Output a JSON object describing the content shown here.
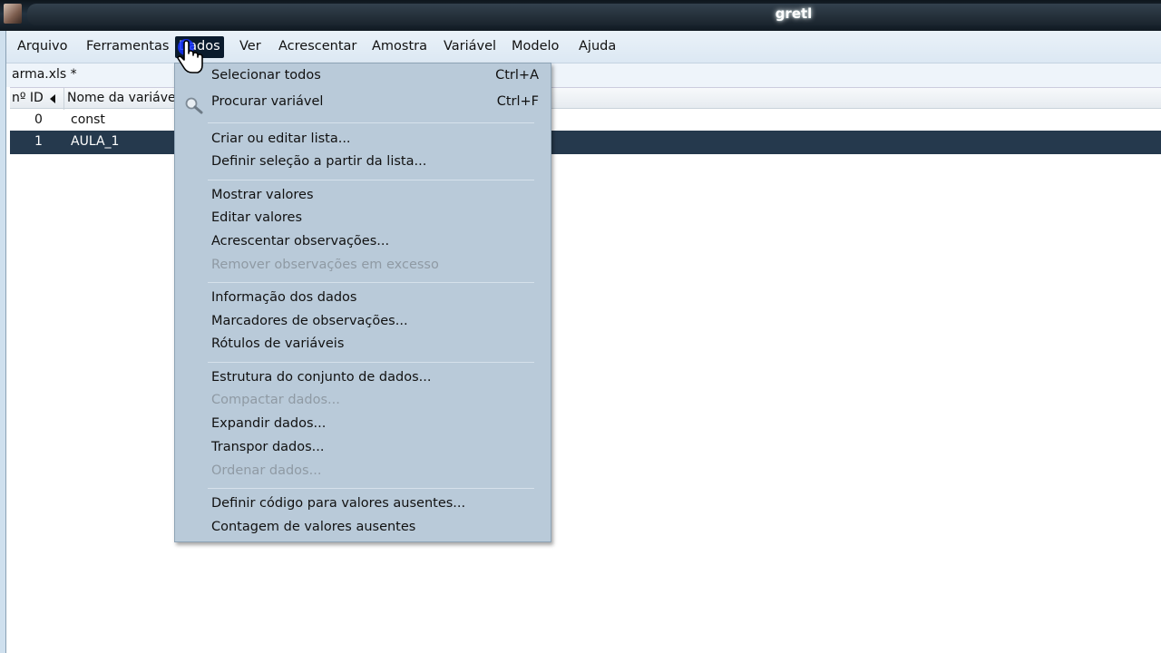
{
  "window": {
    "title": "gretl"
  },
  "menubar": {
    "items": [
      "Arquivo",
      "Ferramentas",
      "Dados",
      "Ver",
      "Acrescentar",
      "Amostra",
      "Variável",
      "Modelo",
      "Ajuda"
    ],
    "active_index": 2
  },
  "dataset": {
    "filename": "arma.xls *"
  },
  "table": {
    "headers": [
      "nº ID",
      "Nome da variável"
    ],
    "rows": [
      {
        "id": "0",
        "name": "const",
        "selected": false
      },
      {
        "id": "1",
        "name": "AULA_1",
        "selected": true
      }
    ]
  },
  "dropdown": {
    "items": [
      {
        "label": "Selecionar todos",
        "shortcut": "Ctrl+A",
        "enabled": true
      },
      {
        "label": "Procurar variável",
        "shortcut": "Ctrl+F",
        "enabled": true,
        "icon": "search-icon"
      },
      {
        "label": "Criar ou editar lista...",
        "enabled": true
      },
      {
        "label": "Definir seleção a partir da lista...",
        "enabled": true
      },
      {
        "label": "Mostrar valores",
        "enabled": true
      },
      {
        "label": "Editar valores",
        "enabled": true
      },
      {
        "label": "Acrescentar observações...",
        "enabled": true
      },
      {
        "label": "Remover observações em excesso",
        "enabled": false
      },
      {
        "label": "Informação dos dados",
        "enabled": true
      },
      {
        "label": "Marcadores de observações...",
        "enabled": true
      },
      {
        "label": "Rótulos de variáveis",
        "enabled": true
      },
      {
        "label": "Estrutura do conjunto de dados...",
        "enabled": true
      },
      {
        "label": "Compactar dados...",
        "enabled": false
      },
      {
        "label": "Expandir dados...",
        "enabled": true
      },
      {
        "label": "Transpor dados...",
        "enabled": true
      },
      {
        "label": "Ordenar dados...",
        "enabled": false
      },
      {
        "label": "Definir código para valores ausentes...",
        "enabled": true
      },
      {
        "label": "Contagem de valores ausentes",
        "enabled": true
      }
    ]
  },
  "colors": {
    "selection": "#25394d",
    "menu_background": "#b9cad9",
    "disabled_text": "#8f9aa4"
  }
}
